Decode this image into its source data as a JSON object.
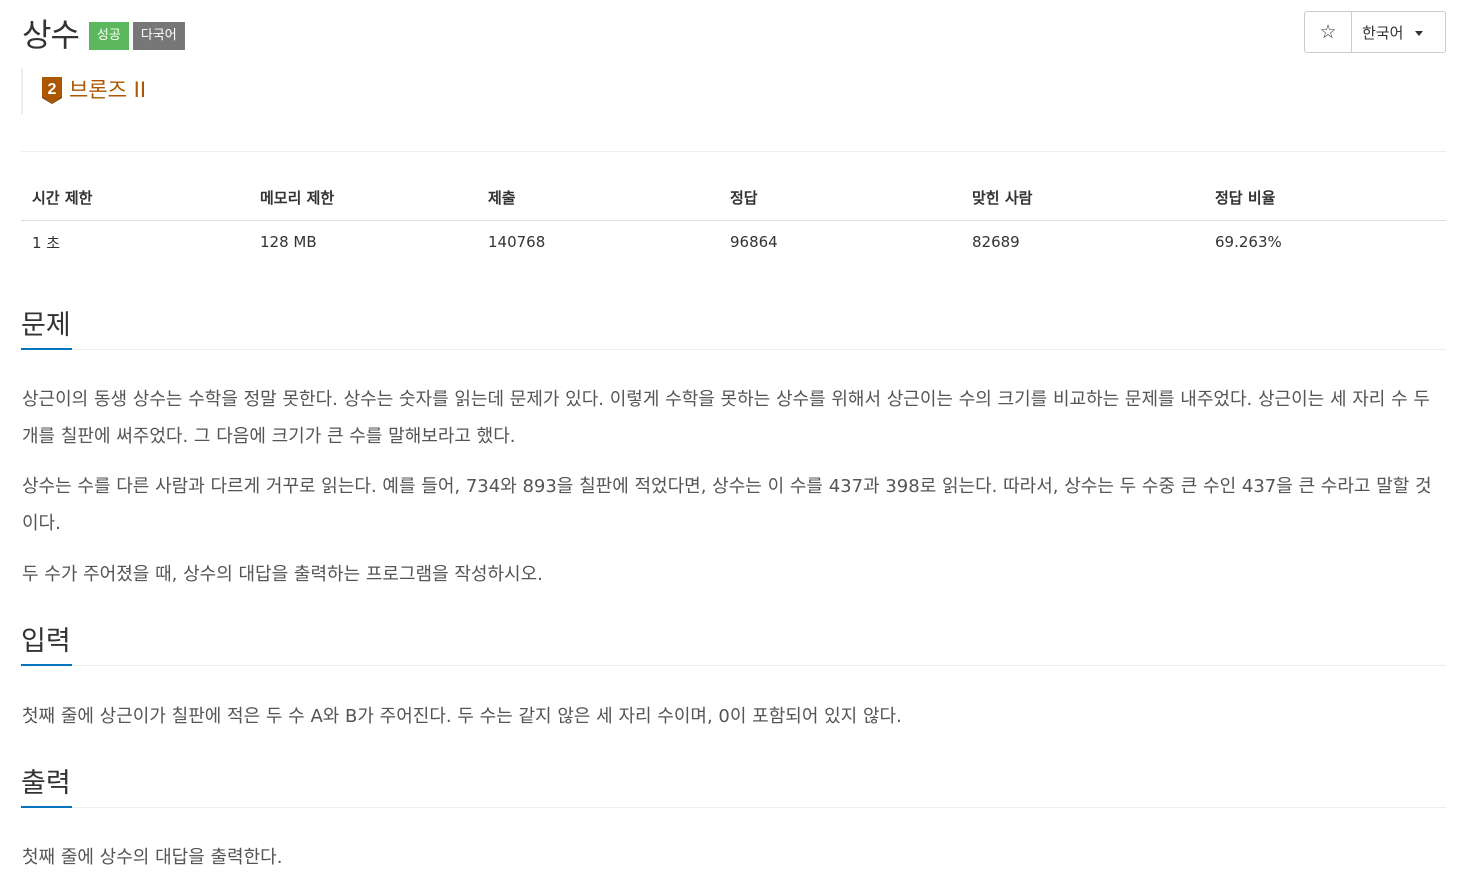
{
  "problem": {
    "title": "상수",
    "badges": {
      "success": "성공",
      "multilang": "다국어"
    },
    "tier": {
      "number": "2",
      "label": "브론즈 II"
    }
  },
  "toolbar": {
    "star": "☆",
    "language": "한국어"
  },
  "info_table": {
    "headers": [
      "시간 제한",
      "메모리 제한",
      "제출",
      "정답",
      "맞힌 사람",
      "정답 비율"
    ],
    "values": [
      "1 초",
      "128 MB",
      "140768",
      "96864",
      "82689",
      "69.263%"
    ]
  },
  "sections": {
    "description": {
      "title": "문제",
      "paragraphs": [
        "상근이의 동생 상수는 수학을 정말 못한다. 상수는 숫자를 읽는데 문제가 있다. 이렇게 수학을 못하는 상수를 위해서 상근이는 수의 크기를 비교하는 문제를 내주었다. 상근이는 세 자리 수 두 개를 칠판에 써주었다. 그 다음에 크기가 큰 수를 말해보라고 했다.",
        "상수는 수를 다른 사람과 다르게 거꾸로 읽는다. 예를 들어, 734와 893을 칠판에 적었다면, 상수는 이 수를 437과 398로 읽는다. 따라서, 상수는 두 수중 큰 수인 437을 큰 수라고 말할 것이다.",
        "두 수가 주어졌을 때, 상수의 대답을 출력하는 프로그램을 작성하시오."
      ]
    },
    "input": {
      "title": "입력",
      "text": "첫째 줄에 상근이가 칠판에 적은 두 수 A와 B가 주어진다. 두 수는 같지 않은 세 자리 수이며, 0이 포함되어 있지 않다."
    },
    "output": {
      "title": "출력",
      "text": "첫째 줄에 상수의 대답을 출력한다."
    }
  },
  "colors": {
    "success": "#5cb85c",
    "multilang": "#777777",
    "bronze": "#ad5600",
    "accent": "#0076c0"
  }
}
